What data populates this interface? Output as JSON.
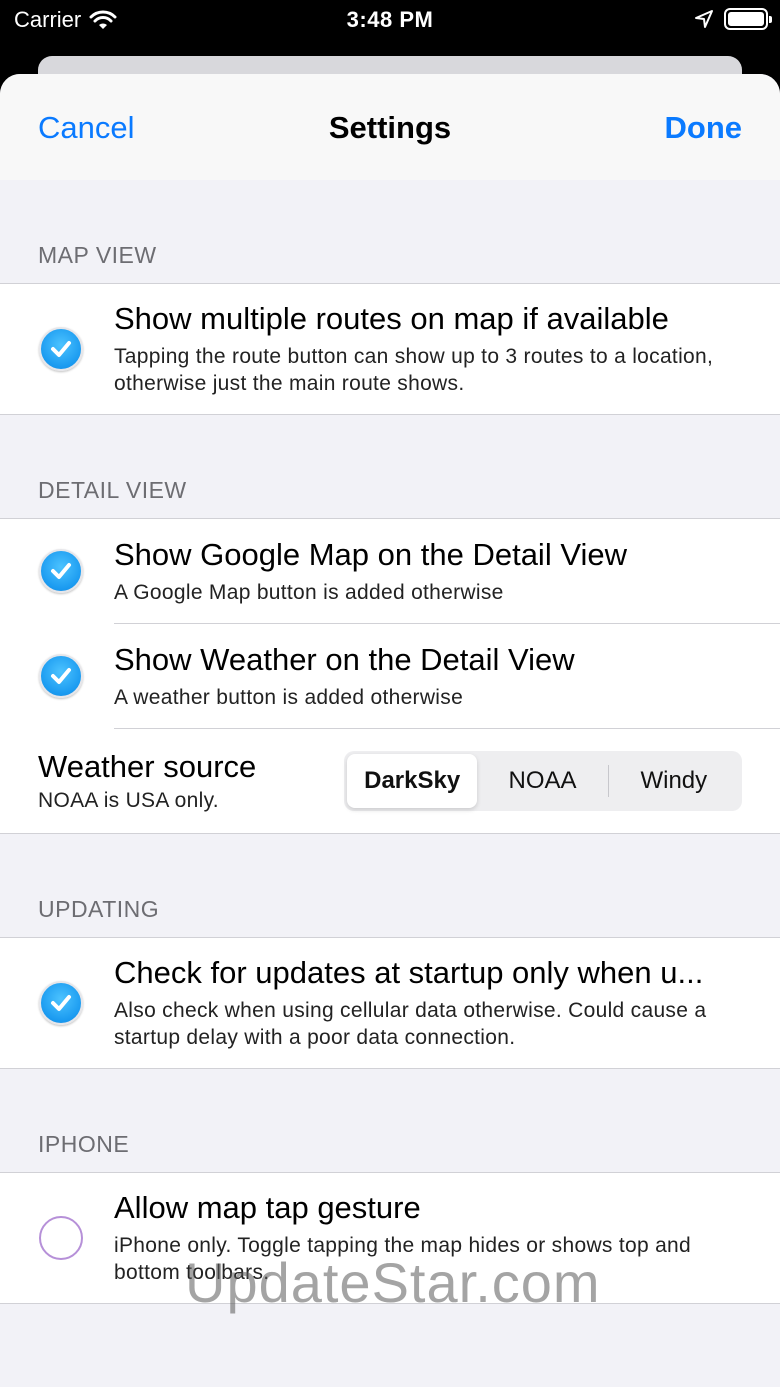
{
  "status_bar": {
    "carrier": "Carrier",
    "time": "3:48 PM"
  },
  "nav": {
    "cancel": "Cancel",
    "title": "Settings",
    "done": "Done"
  },
  "sections": {
    "map_view": {
      "header": "MAP VIEW",
      "rows": [
        {
          "title": "Show multiple routes on map if available",
          "subtitle": "Tapping the route button can show up to 3 routes to a location, otherwise just the main route shows.",
          "checked": true
        }
      ]
    },
    "detail_view": {
      "header": "DETAIL VIEW",
      "rows": [
        {
          "title": "Show Google Map on the Detail View",
          "subtitle": "A Google Map button is added otherwise",
          "checked": true
        },
        {
          "title": "Show Weather on the Detail View",
          "subtitle": "A weather button is added otherwise",
          "checked": true
        }
      ],
      "weather_source": {
        "title": "Weather source",
        "subtitle": "NOAA is USA only.",
        "options": [
          "DarkSky",
          "NOAA",
          "Windy"
        ],
        "selected": "DarkSky"
      }
    },
    "updating": {
      "header": "UPDATING",
      "rows": [
        {
          "title": "Check for updates at startup only when u...",
          "subtitle": "Also check when using cellular data otherwise. Could cause a startup delay with a poor data connection.",
          "checked": true
        }
      ]
    },
    "iphone": {
      "header": "IPHONE",
      "rows": [
        {
          "title": "Allow map tap gesture",
          "subtitle": "iPhone only.  Toggle tapping the map hides or shows top and bottom toolbars.",
          "checked": false
        }
      ]
    }
  },
  "watermark": "UpdateStar.com",
  "colors": {
    "accent": "#0a7aff",
    "check_blue": "#1a9af0",
    "unchecked_ring": "#b690d8",
    "grouped_bg": "#f2f2f7"
  }
}
